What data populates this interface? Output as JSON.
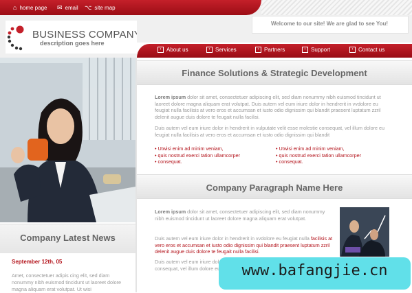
{
  "top_links": [
    {
      "icon": "home-icon",
      "label": "home page"
    },
    {
      "icon": "envelope-icon",
      "label": "email"
    },
    {
      "icon": "sitemap-icon",
      "label": "site map"
    }
  ],
  "logo": {
    "title": "BUSINESS COMPANY",
    "subtitle": "description goes here"
  },
  "welcome": "Welcome to our site! We are glad to see You!",
  "nav": [
    "About us",
    "Services",
    "Partners",
    "Support",
    "Contact us"
  ],
  "section1": {
    "title": "Finance Solutions & Strategic Development",
    "p1_bold": "Lorem ipsum",
    "p1_rest": " dolor sit amet, consectetuer adipiscing elit, sed diam nonummy nibh euismod tincidunt ut laoreet dolore magna aliquam erat volutpat. Duis autem vel eum iriure dolor in hendrerit in vvdolore eu feugiat nulla facilisis at vero eros et accumsan et iusto odio dignissim qui blandit praesent luptatum zzril delenit augue duis dolore te feugait nulla facilisi.",
    "p2": "Duis autem vel eum iriure dolor in hendrerit in vulputate velit esse molestie consequat, vel illum dolore eu feugiat nulla facilisis at vero eros et accumsan et iusto odio dignissim qui blandit",
    "bullets_left": [
      "Utwisi enim ad minim veniam,",
      "quis nostrud exerci tation ullamcorper",
      "consequat."
    ],
    "bullets_right": [
      "Utwisi enim ad minim veniam,",
      "quis nostrud exerci tation ullamcorper",
      "consequat."
    ]
  },
  "section2": {
    "title": "Company Paragraph Name Here",
    "p1_bold": "Lorem ipsum",
    "p1_rest": " dolor sit amet, consectetuer adipiscing elit, sed diam nonummy nibh euismod tincidunt ut laoreet dolore magna aliquam erat volutpat.",
    "p2_grey": "Duis autem vel eum iriure dolor in hendrerit in vvdolore eu feugiat nulla",
    "p2_red": "facilisis at vero eros et accumsan et iusto odio dignissim qui blandit praesent luptatum zzril delenit augue duis dolore te feugait nulla facilisi.",
    "p3": "Duis autem vel eum iriure dolor in hendrerit in vulputate velit esse molestie consequat, vel illum dolore eu feugiat nulla"
  },
  "news": {
    "title": "Company Latest News",
    "date": "September 12th, 05",
    "body": "Amet, consectetuer adipis cing elit, sed diam nonummy nibh euismod tincidunt ut laoreet dolore magna aliquam erat volutpat. Ut wisi"
  },
  "watermark": "www.bafangjie.cn",
  "colors": {
    "brand_red": "#b3131b",
    "nav_red": "#c4202a",
    "watermark_bg": "#61e0e9"
  }
}
